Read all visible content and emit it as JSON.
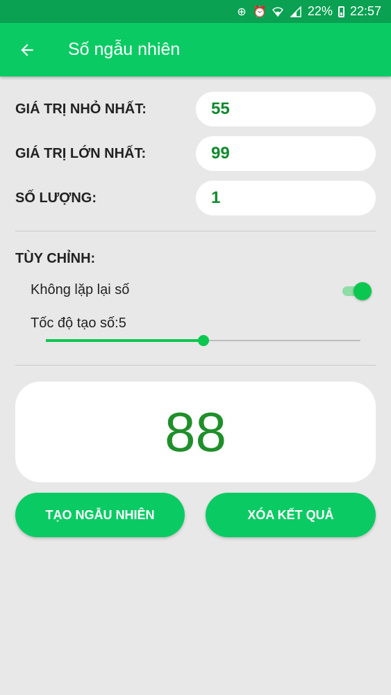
{
  "status_bar": {
    "battery": "22%",
    "time": "22:57"
  },
  "app_bar": {
    "title": "Số ngẫu nhiên"
  },
  "inputs": [
    {
      "label": "GIÁ TRỊ NHỎ NHẤT:",
      "value": "55"
    },
    {
      "label": "GIÁ TRỊ LỚN NHẤT:",
      "value": "99"
    },
    {
      "label": "SỐ LƯỢNG:",
      "value": "1"
    }
  ],
  "custom": {
    "heading": "TÙY CHỈNH:",
    "no_repeat_label": "Không lặp lại số",
    "no_repeat_on": true,
    "speed_label": "Tốc độ tạo số:5",
    "speed_fraction": 0.5
  },
  "result": "88",
  "buttons": {
    "generate": "TẠO NGẪU NHIÊN",
    "clear": "XÓA KẾT QUẢ"
  },
  "colors": {
    "primary": "#0acb63",
    "status": "#0aa152",
    "value_text": "#0f8a2c",
    "result_text": "#1f8f2a"
  }
}
